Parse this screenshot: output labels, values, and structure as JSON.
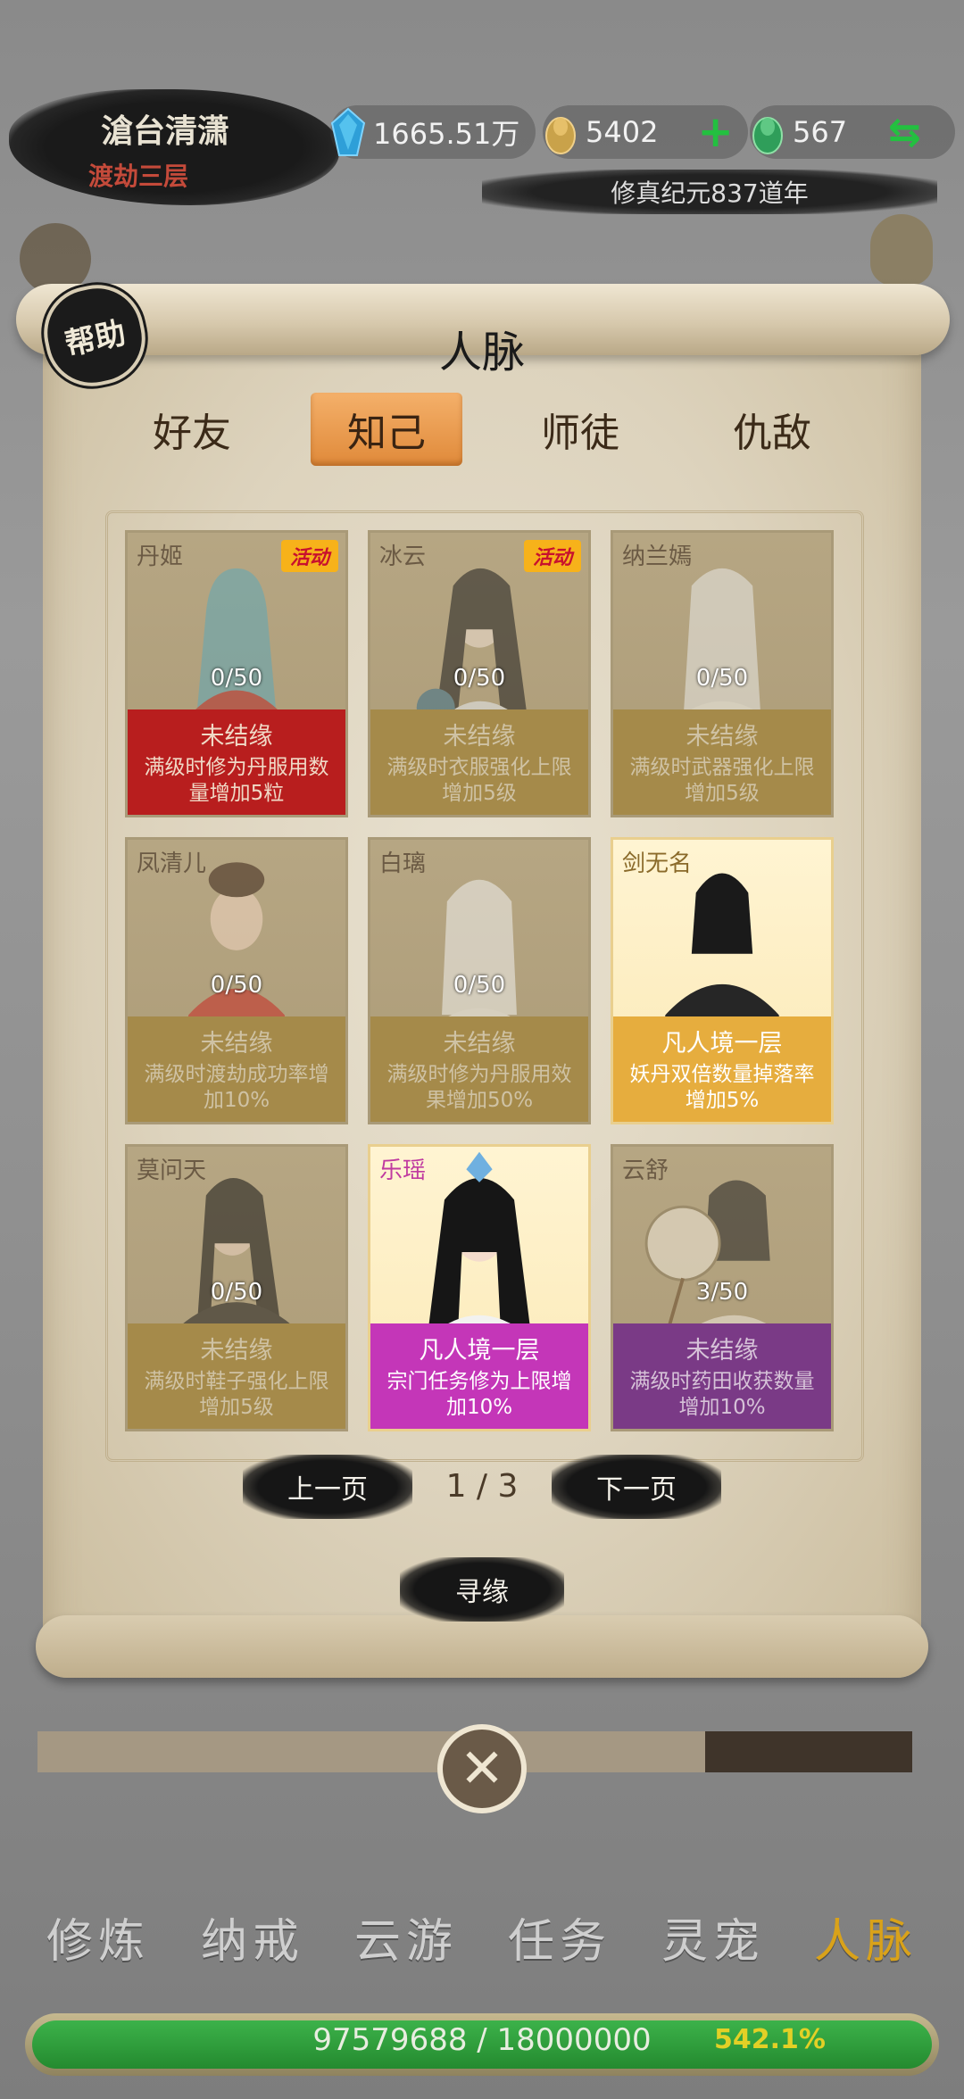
{
  "header": {
    "player_name": "滄台清潇",
    "player_rank": "渡劫三层",
    "spirit_stones": "1665.51万",
    "gold_ingots": "5402",
    "jade": "567",
    "era": "修真纪元837道年"
  },
  "panel": {
    "help_label": "帮助",
    "title": "人脉",
    "tabs": [
      "好友",
      "知己",
      "师徒",
      "仇敌"
    ],
    "active_tab": "知己",
    "cards": [
      {
        "name": "丹姬",
        "badge": "活动",
        "progress": "0/50",
        "status": "未结缘",
        "desc": "满级时修为丹服用数量增加5粒",
        "color": "#b81e1e"
      },
      {
        "name": "冰云",
        "badge": "活动",
        "progress": "0/50",
        "status": "未结缘",
        "desc": "满级时衣服强化上限增加5级",
        "color": "#a58a4a"
      },
      {
        "name": "纳兰嫣",
        "badge": "",
        "progress": "0/50",
        "status": "未结缘",
        "desc": "满级时武器强化上限增加5级",
        "color": "#a58a4a"
      },
      {
        "name": "凤清儿",
        "badge": "",
        "progress": "0/50",
        "status": "未结缘",
        "desc": "满级时渡劫成功率增加10%",
        "color": "#a58a4a"
      },
      {
        "name": "白璃",
        "badge": "",
        "progress": "0/50",
        "status": "未结缘",
        "desc": "满级时修为丹服用效果增加50%",
        "color": "#a58a4a"
      },
      {
        "name": "剑无名",
        "badge": "",
        "progress": "",
        "status": "凡人境一层",
        "desc": "妖丹双倍数量掉落率增加5%",
        "color": "#e6ad3e"
      },
      {
        "name": "莫问天",
        "badge": "",
        "progress": "0/50",
        "status": "未结缘",
        "desc": "满级时鞋子强化上限增加5级",
        "color": "#a58a4a"
      },
      {
        "name": "乐瑶",
        "badge": "",
        "progress": "",
        "status": "凡人境一层",
        "desc": "宗门任务修为上限增加10%",
        "color": "#c436b8"
      },
      {
        "name": "云舒",
        "badge": "",
        "progress": "3/50",
        "status": "未结缘",
        "desc": "满级时药田收获数量增加10%",
        "color": "#7a3a86"
      }
    ],
    "prev_page": "上一页",
    "next_page": "下一页",
    "page_indicator": "1 / 3",
    "seek_button": "寻缘"
  },
  "bottom_nav": {
    "items": [
      "修炼",
      "纳戒",
      "云游",
      "任务",
      "灵宠",
      "人脉"
    ],
    "active": "人脉"
  },
  "experience": {
    "text": "97579688 / 18000000",
    "percent": "542.1%",
    "fill_fraction": 1.0
  }
}
